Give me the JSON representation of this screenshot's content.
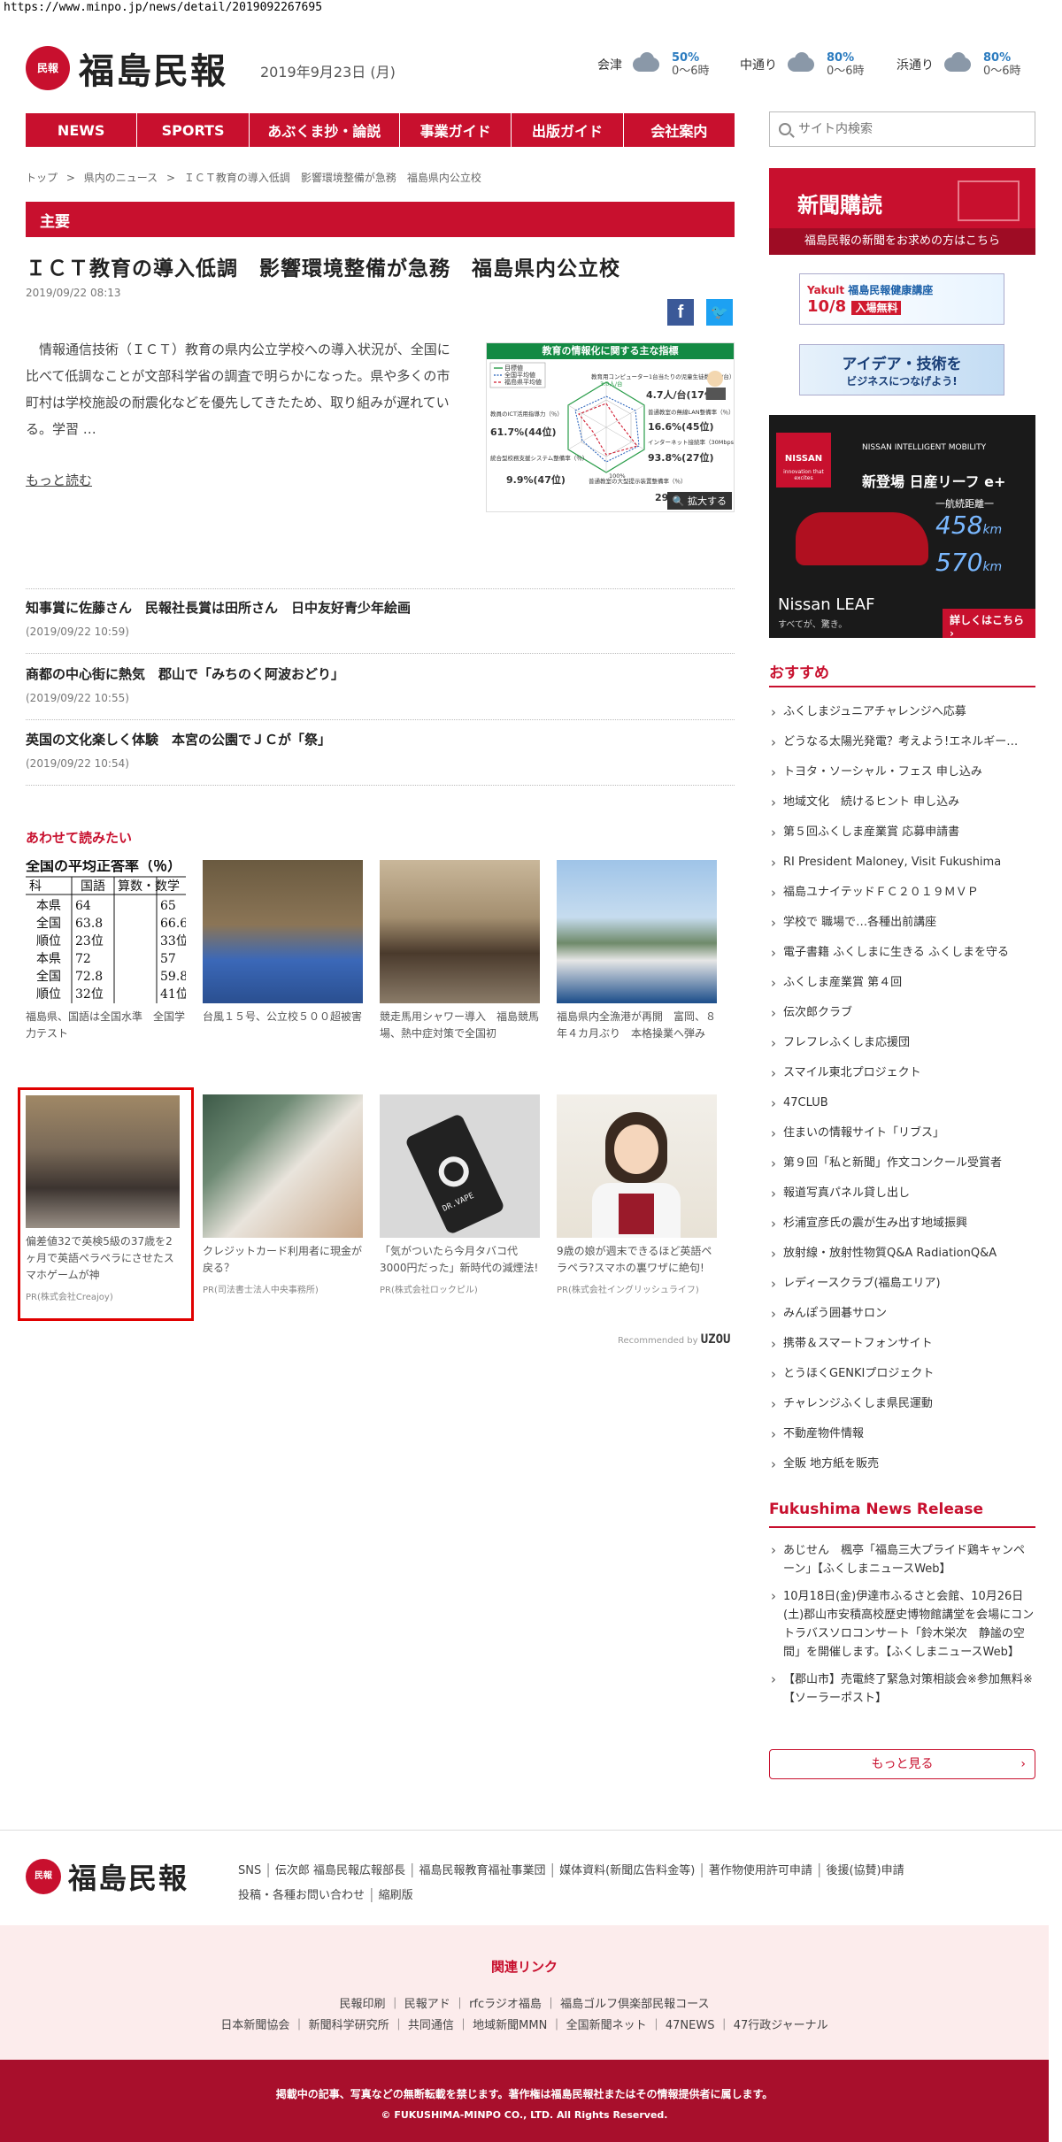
{
  "browser": {
    "url": "https://www.minpo.jp/news/detail/2019092267695"
  },
  "header": {
    "logo_mark": "民報",
    "logo_text": "福島民報",
    "date": "2019年9月23日 (月)",
    "weather": [
      {
        "place": "会津",
        "rain": "50%",
        "time": "0〜6時"
      },
      {
        "place": "中通り",
        "rain": "80%",
        "time": "0〜6時"
      },
      {
        "place": "浜通り",
        "rain": "80%",
        "time": "0〜6時"
      }
    ]
  },
  "nav": [
    "NEWS",
    "SPORTS",
    "あぶくま抄・論説",
    "事業ガイド",
    "出版ガイド",
    "会社案内"
  ],
  "search": {
    "placeholder": "サイト内検索"
  },
  "breadcrumb": [
    "トップ",
    ">",
    "県内のニュース",
    ">",
    "ＩＣＴ教育の導入低調　影響環境整備が急務　福島県内公立校"
  ],
  "section": {
    "label": "主要"
  },
  "article": {
    "title": "ＩＣＴ教育の導入低調　影響環境整備が急務　福島県内公立校",
    "time": "2019/09/22 08:13",
    "lead": "情報通信技術（ＩＣＴ）教育の県内公立学校への導入状況が、全国に比べて低調なことが文部科学省の調査で明らかになった。県や多くの市町村は学校施設の耐震化などを優先してきたため、取り組みが遅れている。学習 …",
    "more": "もっと読む",
    "infographic": {
      "title": "教育の情報化に関する主な指標",
      "legend": [
        "目標値",
        "全国平均値",
        "福島県平均値"
      ],
      "labels": [
        "教育用コンピューター1台当たりの児童生徒数（人/台）",
        "普通教室の無線LAN整備率（％）",
        "インターネット接続率（30Mbps以上）（％）",
        "普通教室の大型提示装置整備率（％）",
        "統合型校務支援システム整備率（％）",
        "教員のICT活用指導力（％）"
      ],
      "values": [
        "4.7人/台(17位)",
        "16.6%(45位)",
        "93.8%(27位)",
        "29",
        "9.9%(47位)",
        "61.7%(44位)"
      ],
      "target": "3.0人/台",
      "axis": "100%",
      "zoom": "拡大する"
    }
  },
  "news_list": [
    {
      "title": "知事賞に佐藤さん　民報社長賞は田所さん　日中友好青少年絵画",
      "time": "(2019/09/22 10:59)"
    },
    {
      "title": "商都の中心街に熱気　郡山で「みちのく阿波おどり」",
      "time": "(2019/09/22 10:55)"
    },
    {
      "title": "英国の文化楽しく体験　本宮の公園でＪＣが「祭」",
      "time": "(2019/09/22 10:54)"
    }
  ],
  "related_label": "あわせて読みたい",
  "score_table": {
    "heading": "全国の平均正答率（％）",
    "cols": [
      "国語",
      "算数・数学"
    ],
    "rows": [
      [
        "本県",
        "64",
        "65"
      ],
      [
        "全国",
        "63.8",
        "66.6"
      ],
      [
        "順位",
        "23位",
        "33位"
      ],
      [
        "本県",
        "72",
        "57"
      ],
      [
        "全国",
        "72.8",
        "59.8"
      ],
      [
        "順位",
        "32位",
        "41位"
      ]
    ]
  },
  "cards_row1": [
    {
      "caption": "福島県、国語は全国水準　全国学力テスト"
    },
    {
      "caption": "台風１５号、公立校５００超被害"
    },
    {
      "caption": "競走馬用シャワー導入　福島競馬場、熱中症対策で全国初"
    },
    {
      "caption": "福島県内全漁港が再開　富岡、８年４カ月ぶり　本格操業へ弾み"
    }
  ],
  "cards_row2": [
    {
      "caption": "偏差値32で英検5級の37歳を2ヶ月で英語ペラペラにさせたスマホゲームが神",
      "pr": "PR(株式会社Creajoy)"
    },
    {
      "caption": "クレジットカード利用者に現金が戻る？",
      "pr": "PR(司法書士法人中央事務所)"
    },
    {
      "caption": "「気がついたら今月タバコ代3000円だった」新時代の減煙法!",
      "pr": "PR(株式会社ロックピル)"
    },
    {
      "caption": "9歳の娘が週末できるほど英語ペラペラ?スマホの裏ワザに絶句!",
      "pr": "PR(株式会社イングリッシュライフ)"
    }
  ],
  "card_img_text": "DR.VAPE",
  "recommended": {
    "label": "Recommended by",
    "brand": "UZOU"
  },
  "sidebar": {
    "subscribe_title": "新聞購読",
    "subscribe_sub": "福島民報の新聞をお求めの方はこちら",
    "ad1": {
      "brand": "Yakult",
      "text": "福島民報健康講座",
      "date": "10/8",
      "tag": "入場無料"
    },
    "ad2": {
      "text": "アイデア・技術を",
      "text2": "ビジネスにつなげよう!"
    },
    "nissan": {
      "brand": "NISSAN",
      "tagline": "NISSAN INTELLIGENT MOBILITY",
      "logo_sub": "innovation that excites",
      "headline": "新登場 日産リーフ e+",
      "range_label": "一航続距離一",
      "range1": "458",
      "range2": "570",
      "unit": "km",
      "model": "Nissan LEAF",
      "sub": "すべてが、驚き。",
      "cta": "詳しくはこちら ›"
    },
    "osusume_title": "おすすめ",
    "osusume": [
      "ふくしまジュニアチャレンジへ応募",
      "どうなる太陽光発電？考えよう!エネルギー…",
      "トヨタ・ソーシャル・フェス 申し込み",
      "地域文化　続けるヒント 申し込み",
      "第５回ふくしま産業賞 応募申請書",
      "RI President Maloney, Visit Fukushima",
      "福島ユナイテッドＦＣ２０１９ＭＶＰ",
      "学校で 職場で…各種出前講座",
      "電子書籍 ふくしまに生きる ふくしまを守る",
      "ふくしま産業賞 第４回",
      "伝次郎クラブ",
      "フレフレふくしま応援団",
      "スマイル東北プロジェクト",
      "47CLUB",
      "住まいの情報サイト「リブス」",
      "第９回「私と新聞」作文コンクール受賞者",
      "報道写真パネル貸し出し",
      "杉浦宣彦氏の震が生み出す地域振興",
      "放射線・放射性物質Q&A RadiationQ&A",
      "レディースクラブ(福島エリア)",
      "みんぽう囲碁サロン",
      "携帯＆スマートフォンサイト",
      "とうほくGENKIプロジェクト",
      "チャレンジふくしま県民運動",
      "不動産物件情報",
      "全販 地方紙を販売"
    ],
    "release_title": "Fukushima News Release",
    "releases": [
      "あじせん　楓亭「福島三大プライド鶏キャンペーン」【ふくしまニュースWeb】",
      "10月18日(金)伊達市ふるさと会館、10月26日(土)郡山市安積高校歴史博物館講堂を会場にコントラバスソロコンサート「鈴木栄次　静謐の空間」を開催します。【ふくしまニュースWeb】",
      "【郡山市】売電終了緊急対策相談会※参加無料※【ソーラーポスト】"
    ],
    "more": "もっと見る"
  },
  "footer": {
    "links_row1": [
      "SNS",
      "伝次郎 福島民報広報部長",
      "福島民報教育福祉事業団",
      "媒体資料(新聞広告料金等)",
      "著作物使用許可申請",
      "後援(協賛)申請"
    ],
    "links_row2": [
      "投稿・各種お問い合わせ",
      "縮刷版"
    ],
    "related_title": "関連リンク",
    "related_row1": [
      "民報印刷",
      "民報アド",
      "rfcラジオ福島",
      "福島ゴルフ倶楽部民報コース"
    ],
    "related_row2": [
      "日本新聞協会",
      "新聞科学研究所",
      "共同通信",
      "地域新聞MMN",
      "全国新聞ネット",
      "47NEWS",
      "47行政ジャーナル"
    ],
    "notice": "掲載中の記事、写真などの無断転載を禁じます。著作権は福島民報社またはその情報提供者に属します。",
    "copyright": "© FUKUSHIMA-MINPO CO., LTD. All Rights Reserved."
  }
}
